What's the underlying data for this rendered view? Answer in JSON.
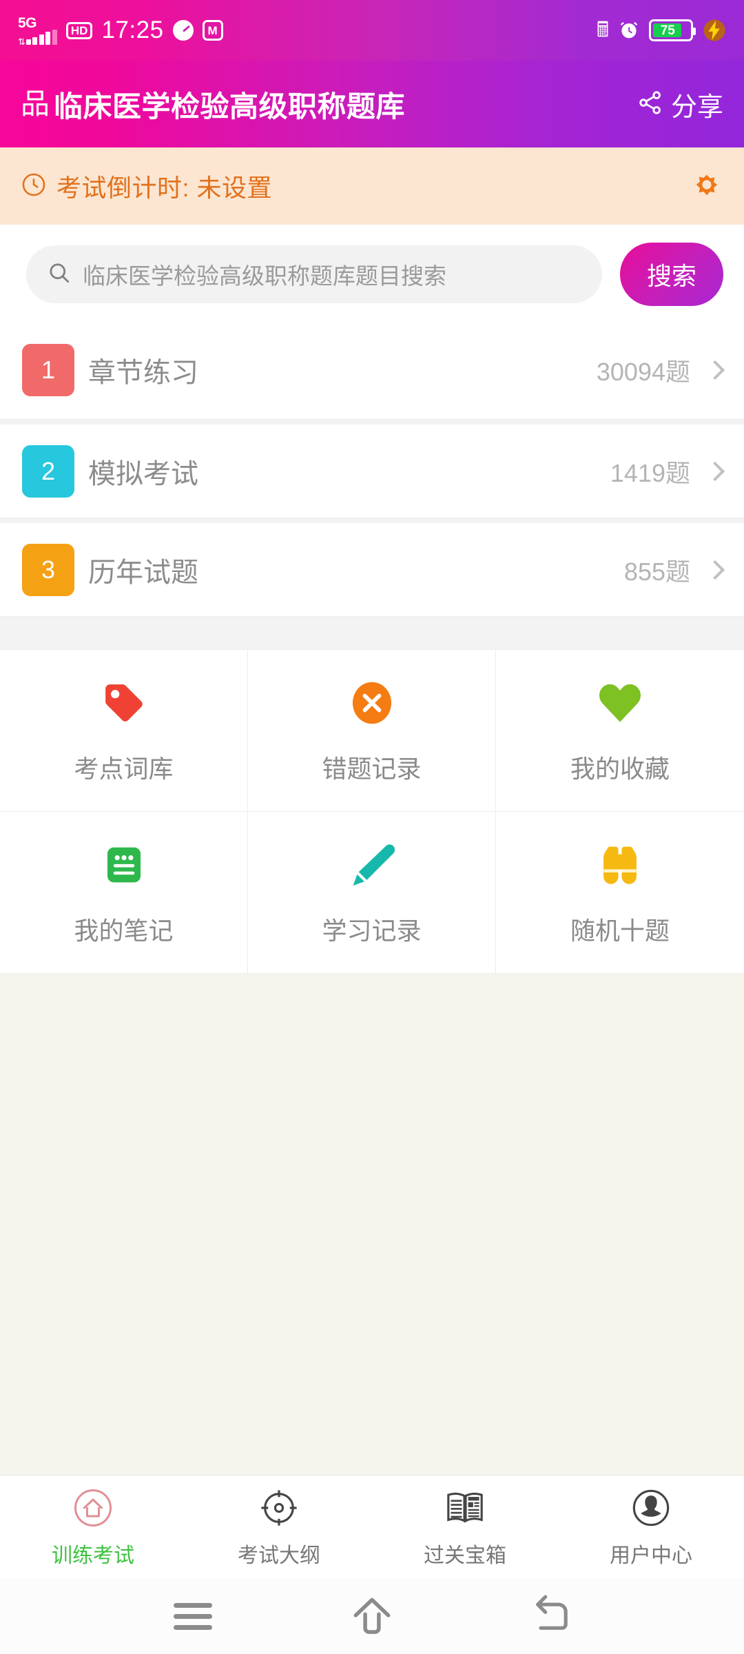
{
  "statusbar": {
    "network": "5G",
    "hd": "HD",
    "time": "17:25",
    "speedometer_icon": "speedometer-icon",
    "app_icon": "M",
    "bluetooth_icon": "bluetooth-icon",
    "alarm_icon": "alarm-clock-icon",
    "battery_percent": "75",
    "charging_icon": "lightning-bolt-icon"
  },
  "header": {
    "grid_glyph": "品",
    "title": "临床医学检验高级职称题库",
    "share_label": "分享",
    "share_icon": "share-icon",
    "gradient_start": "#f7069a",
    "gradient_end": "#9326db"
  },
  "countdown": {
    "clock_icon": "clock-icon",
    "text": "考试倒计时: 未设置",
    "settings_icon": "gear-icon",
    "bg_color": "#fce6d2",
    "text_color": "#e2711c"
  },
  "search": {
    "placeholder": "临床医学检验高级职称题库题目搜索",
    "value": "",
    "search_icon": "search-icon",
    "button_label": "搜索"
  },
  "list": [
    {
      "num": "1",
      "label": "章节练习",
      "count": "30094题",
      "color": "#f06a6a"
    },
    {
      "num": "2",
      "label": "模拟考试",
      "count": "1419题",
      "color": "#27c8dd"
    },
    {
      "num": "3",
      "label": "历年试题",
      "count": "855题",
      "color": "#f5a114"
    }
  ],
  "grid": [
    {
      "label": "考点词库",
      "icon": "price-tag-icon",
      "color": "#ef4235"
    },
    {
      "label": "错题记录",
      "icon": "error-circle-x-icon",
      "color": "#f57c12"
    },
    {
      "label": "我的收藏",
      "icon": "heart-icon",
      "color": "#7dc123"
    },
    {
      "label": "我的笔记",
      "icon": "note-document-icon",
      "color": "#2eb84c"
    },
    {
      "label": "学习记录",
      "icon": "pencil-icon",
      "color": "#16b8ac"
    },
    {
      "label": "随机十题",
      "icon": "binoculars-icon",
      "color": "#f6b912"
    }
  ],
  "tabs": [
    {
      "label": "训练考试",
      "icon": "home-circle-icon",
      "active": true,
      "color": "#3fc23f"
    },
    {
      "label": "考试大纲",
      "icon": "target-crosshair-icon",
      "active": false,
      "color": "#555555"
    },
    {
      "label": "过关宝箱",
      "icon": "newspaper-icon",
      "active": false,
      "color": "#555555"
    },
    {
      "label": "用户中心",
      "icon": "user-circle-icon",
      "active": false,
      "color": "#555555"
    }
  ],
  "navbar": {
    "menu_icon": "menu-icon",
    "home_icon": "home-icon",
    "back_icon": "back-icon"
  }
}
